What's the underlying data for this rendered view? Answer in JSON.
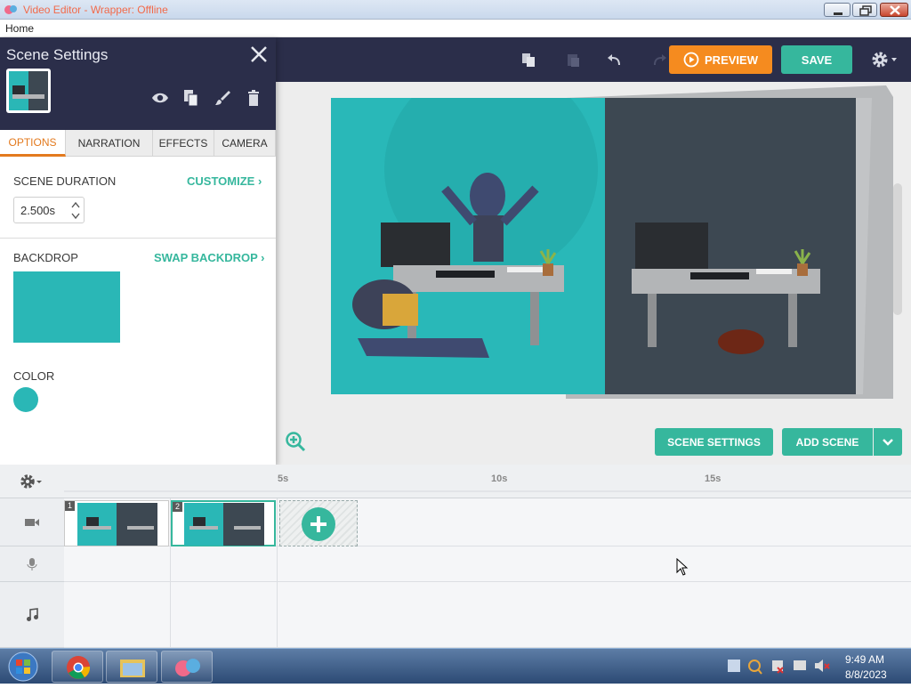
{
  "window": {
    "title": "Video Editor - Wrapper: Offline"
  },
  "menu": {
    "home": "Home"
  },
  "toolbar": {
    "preview_label": "PREVIEW",
    "save_label": "SAVE"
  },
  "panel": {
    "title": "Scene Settings",
    "tabs": [
      {
        "label": "OPTIONS",
        "active": true
      },
      {
        "label": "NARRATION",
        "active": false
      },
      {
        "label": "EFFECTS",
        "active": false
      },
      {
        "label": "CAMERA",
        "active": false
      }
    ],
    "scene_duration_label": "SCENE DURATION",
    "customize_label": "CUSTOMIZE",
    "duration_value": "2.500s",
    "backdrop_label": "BACKDROP",
    "swap_backdrop_label": "SWAP BACKDROP",
    "color_label": "COLOR",
    "backdrop_color": "#2ab7b6"
  },
  "stage": {
    "scene_settings_label": "SCENE SETTINGS",
    "add_scene_label": "ADD SCENE"
  },
  "timeline": {
    "ticks": [
      "5s",
      "10s",
      "15s"
    ],
    "scenes": [
      {
        "number": "1"
      },
      {
        "number": "2"
      }
    ]
  },
  "taskbar": {
    "time": "9:49 AM",
    "date": "8/8/2023"
  },
  "colors": {
    "accent": "#36b79d",
    "orange": "#f58b1f",
    "navy": "#2b2e4a",
    "teal": "#2ab7b6",
    "scene_dark": "#3d4852"
  }
}
